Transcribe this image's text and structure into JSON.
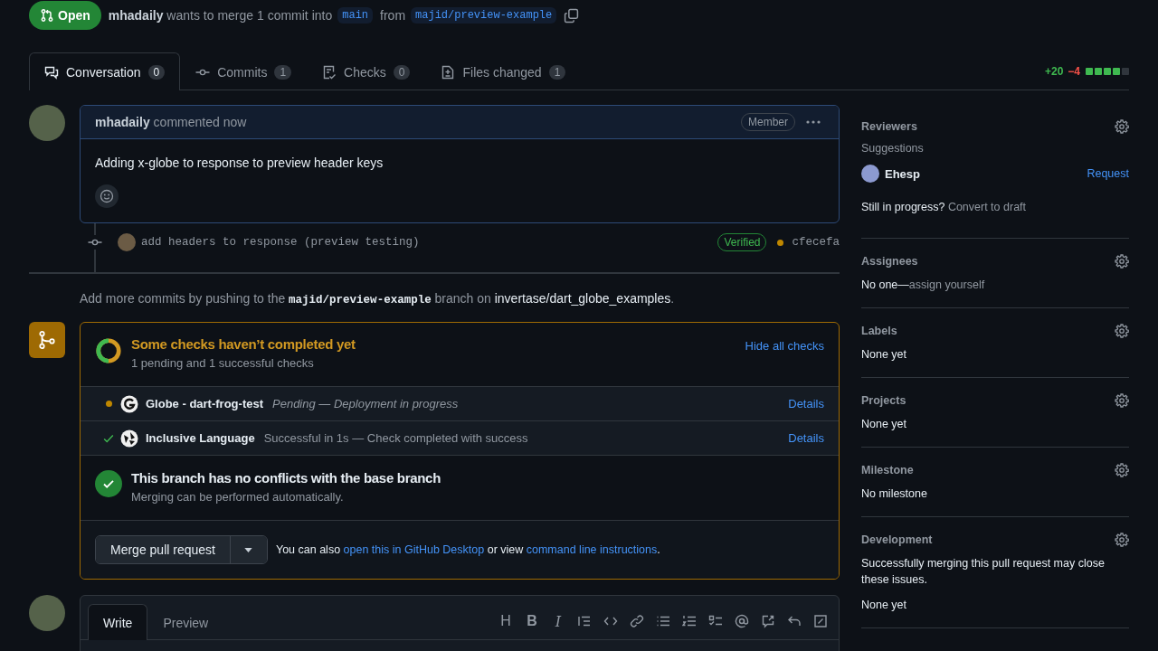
{
  "pr": {
    "kind": "open",
    "state_label": "Open",
    "author": "mhadaily",
    "summary": "wants to merge 1 commit into",
    "base": "main",
    "from": "from",
    "head": "majid/preview-example"
  },
  "tabs": [
    {
      "kind": "conversation",
      "label": "Conversation",
      "count": "0",
      "selected": true
    },
    {
      "kind": "commits",
      "label": "Commits",
      "count": "1",
      "selected": false
    },
    {
      "kind": "checks",
      "label": "Checks",
      "count": "0",
      "selected": false
    },
    {
      "kind": "files",
      "label": "Files changed",
      "count": "1",
      "selected": false
    }
  ],
  "diffstat": {
    "added": "+20",
    "removed": "−4",
    "blocks": [
      {
        "kind": "added"
      },
      {
        "kind": "added"
      },
      {
        "kind": "added"
      },
      {
        "kind": "added"
      },
      {
        "kind": "neutral"
      }
    ]
  },
  "comment": {
    "author": "mhadaily",
    "meta": "commented now",
    "badge": "Member",
    "body": "Adding x-globe to response to preview header keys"
  },
  "commit": {
    "message": "add headers to response (preview testing)",
    "badge": "Verified",
    "color": "#bf8700",
    "sha": "cfecefa"
  },
  "push_hint": {
    "before": "Add more commits by pushing to the",
    "branch": "majid/preview-example",
    "middle": "branch on",
    "repo": "invertase/dart_globe_examples",
    "after": "."
  },
  "merge": {
    "title": "Some checks haven’t completed yet",
    "subtitle": "1 pending and 1 successful checks",
    "toggle": "Hide all checks",
    "checks": [
      {
        "kind": "pending",
        "name": "Globe - dart-frog-test",
        "status": "Pending — Deployment in progress",
        "link": "Details"
      },
      {
        "kind": "success",
        "name": "Inclusive Language",
        "status": "Successful in 1s — Check completed with success",
        "link": "Details"
      }
    ],
    "conflict_title": "This branch has no conflicts with the base branch",
    "conflict_subtitle": "Merging can be performed automatically.",
    "button": "Merge pull request",
    "also_before": "You can also",
    "also_link1": "open this in GitHub Desktop",
    "also_middle": "or view",
    "also_link2": "command line instructions",
    "also_after": "."
  },
  "composer": {
    "tabs": [
      {
        "label": "Write",
        "selected": true
      },
      {
        "label": "Preview",
        "selected": false
      }
    ],
    "toolbar": [
      {
        "kind": "heading",
        "glyph": "H"
      },
      {
        "kind": "bold",
        "glyph": "B"
      },
      {
        "kind": "italic",
        "glyph": "I"
      },
      {
        "kind": "quote"
      },
      {
        "kind": "code"
      },
      {
        "kind": "link"
      },
      {
        "kind": "bullets"
      },
      {
        "kind": "numbers"
      },
      {
        "kind": "tasks"
      },
      {
        "kind": "mention"
      },
      {
        "kind": "reference"
      },
      {
        "kind": "undo"
      },
      {
        "kind": "fullscreen"
      }
    ]
  },
  "sidebar": [
    {
      "kind": "reviewers",
      "title": "Reviewers",
      "suggestions": "Suggestions",
      "reviewer": "Ehesp",
      "action": "Request",
      "question": "Still in progress?",
      "link": "Convert to draft"
    },
    {
      "kind": "assignees",
      "title": "Assignees",
      "value": "No one—",
      "link": "assign yourself"
    },
    {
      "kind": "plain",
      "title": "Labels",
      "value": "None yet"
    },
    {
      "kind": "plain",
      "title": "Projects",
      "value": "None yet"
    },
    {
      "kind": "plain",
      "title": "Milestone",
      "value": "No milestone"
    },
    {
      "kind": "development",
      "title": "Development",
      "note": "Successfully merging this pull request may close these issues.",
      "value": "None yet"
    }
  ]
}
